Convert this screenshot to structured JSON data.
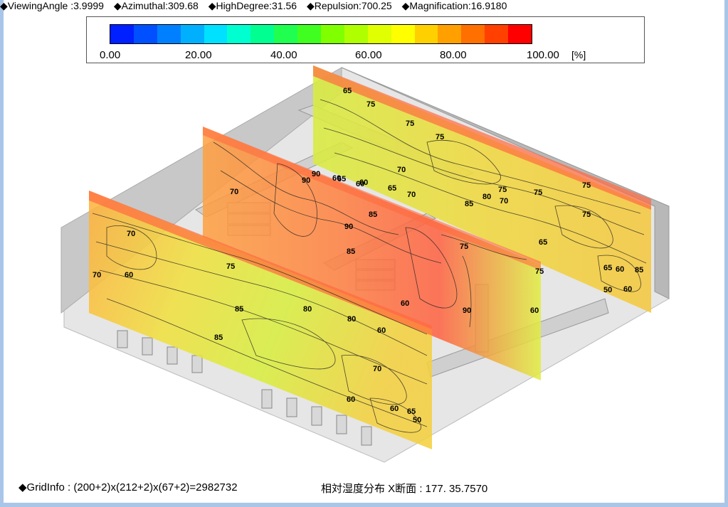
{
  "params": {
    "viewing_angle": "◆ViewingAngle :3.9999",
    "azimuthal": "◆Azimuthal:309.68",
    "high_degree": "◆HighDegree:31.56",
    "repulsion": "◆Repulsion:700.25",
    "magnification": "◆Magnification:16.9180"
  },
  "legend": {
    "ticks": [
      "0.00",
      "20.00",
      "40.00",
      "60.00",
      "80.00",
      "100.00"
    ],
    "unit": "[%]",
    "colors": [
      "#0020ff",
      "#0050ff",
      "#0080ff",
      "#00b0ff",
      "#00e0ff",
      "#00ffd0",
      "#00ff90",
      "#20ff50",
      "#40ff20",
      "#80ff00",
      "#b0ff00",
      "#e0ff00",
      "#ffff00",
      "#ffd000",
      "#ffa000",
      "#ff7000",
      "#ff4000",
      "#ff0000"
    ]
  },
  "contour_labels": {
    "front": [
      "70",
      "70",
      "60",
      "75",
      "85",
      "80",
      "85",
      "80",
      "60",
      "60",
      "70",
      "65",
      "60",
      "50"
    ],
    "middle": [
      "70",
      "90",
      "90",
      "85",
      "85",
      "90",
      "65",
      "60",
      "75",
      "70",
      "65",
      "90",
      "60"
    ],
    "back": [
      "65",
      "75",
      "70",
      "75",
      "75",
      "60",
      "65",
      "80",
      "70",
      "75",
      "85",
      "60",
      "75",
      "75",
      "65",
      "60",
      "85",
      "60",
      "75",
      "75",
      "50",
      "60"
    ]
  },
  "footer": {
    "grid_info": "◆GridInfo : (200+2)x(212+2)x(67+2)=2982732",
    "section": "相対湿度分布 X断面 : 177.  35.7570"
  }
}
